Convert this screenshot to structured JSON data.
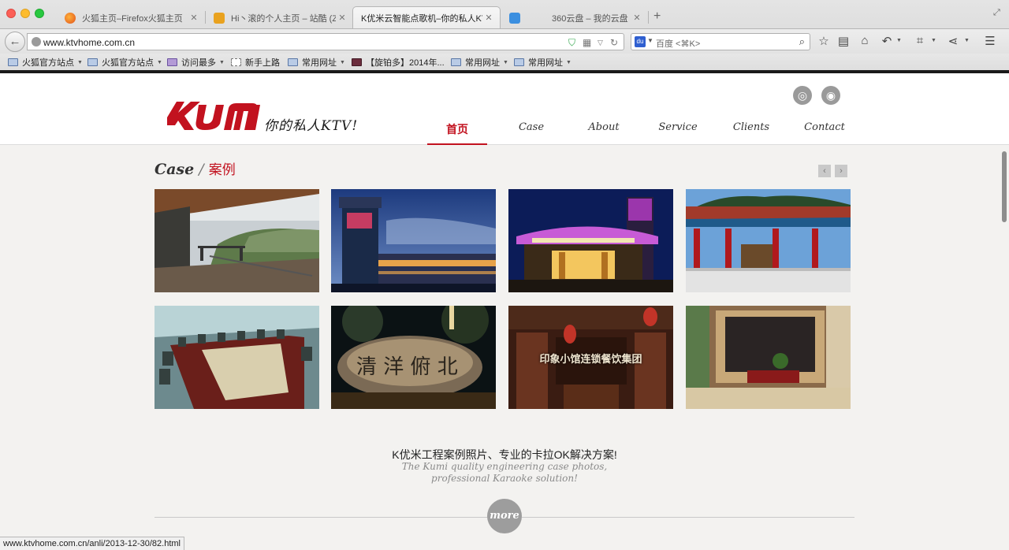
{
  "browser": {
    "tabs": [
      {
        "label": "火狐主页–Firefox火狐主页",
        "icon": "firefox-icon",
        "active": false
      },
      {
        "label": "Hi丶滚的个人主页 – 站酷 (Z...",
        "icon": "zcool-icon",
        "active": false
      },
      {
        "label": "K优米云智能点歌机–你的私人KTV",
        "icon": "",
        "active": true
      },
      {
        "label": "360云盘 – 我的云盘",
        "icon": "cloud-icon",
        "active": false
      }
    ],
    "new_tab": "+",
    "url": "www.ktvhome.com.cn",
    "search_placeholder": "百度 <⌘K>",
    "search_engine_glyph": "du",
    "bookmarks": [
      {
        "label": "火狐官方站点",
        "has_menu": true
      },
      {
        "label": "火狐官方站点",
        "has_menu": true
      },
      {
        "label": "访问最多",
        "has_menu": true
      },
      {
        "label": "新手上路",
        "has_menu": false
      },
      {
        "label": "常用网址",
        "has_menu": true
      },
      {
        "label": "【旋铂多】2014年...",
        "has_menu": false
      },
      {
        "label": "常用网址",
        "has_menu": true
      },
      {
        "label": "常用网址",
        "has_menu": true
      }
    ],
    "status_url": "www.ktvhome.com.cn/anli/2013-12-30/82.html"
  },
  "site": {
    "slogan": "你的私人KTV!",
    "nav": [
      {
        "label": "首页",
        "active": true
      },
      {
        "label": "Case",
        "active": false
      },
      {
        "label": "About",
        "active": false
      },
      {
        "label": "Service",
        "active": false
      },
      {
        "label": "Clients",
        "active": false
      },
      {
        "label": "Contact",
        "active": false
      }
    ],
    "section": {
      "title_en": "Case",
      "separator": " / ",
      "title_cn": "案例",
      "prev": "‹",
      "next": "›"
    },
    "cases": [
      {
        "name": "terrace-photo",
        "caption": ""
      },
      {
        "name": "hotel-tower-photo",
        "caption": ""
      },
      {
        "name": "ktv-entrance-photo",
        "caption": ""
      },
      {
        "name": "pavilion-photo",
        "caption": ""
      },
      {
        "name": "conference-room-photo",
        "caption": ""
      },
      {
        "name": "stone-sign-photo",
        "caption": ""
      },
      {
        "name": "restaurant-photo",
        "caption": "印象小馆连锁餐饮集团"
      },
      {
        "name": "tv-wall-photo",
        "caption": ""
      }
    ],
    "tagline_cn": "K优米工程案例照片、专业的卡拉OK解决方案!",
    "tagline_en_1": "The Kumi quality engineering case photos,",
    "tagline_en_2": "professional Karaoke solution!",
    "more": "more"
  },
  "colors": {
    "brand": "#c2121f",
    "nav_text": "#333333",
    "muted": "#9d9d9d"
  }
}
